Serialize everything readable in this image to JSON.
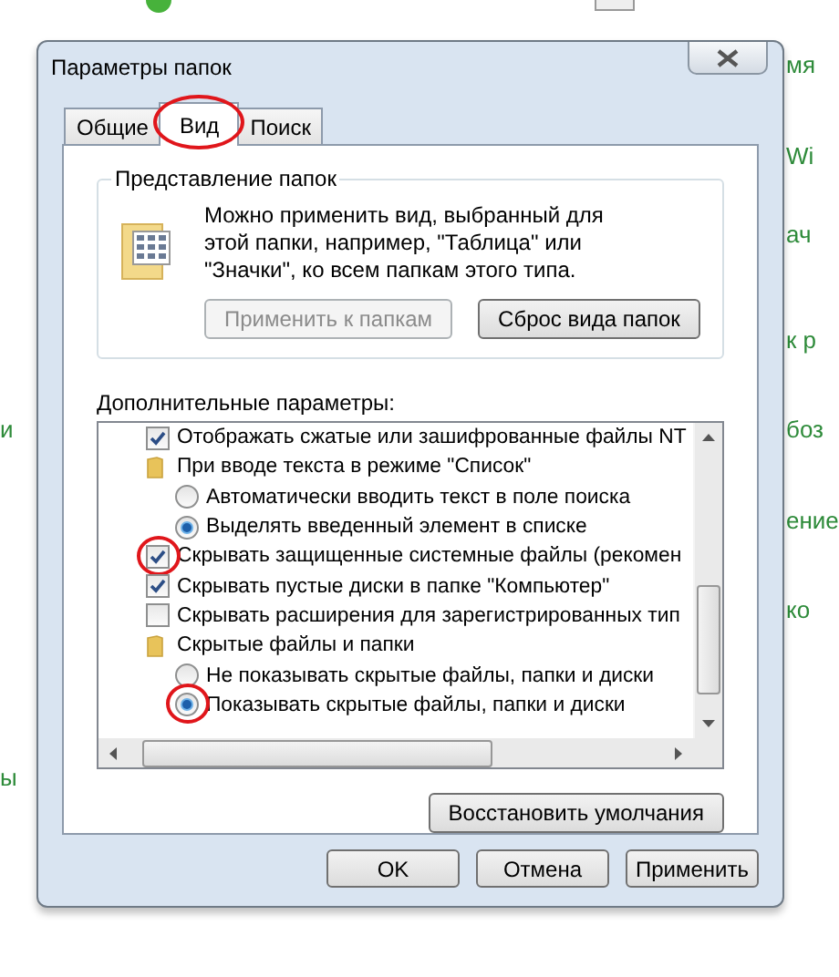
{
  "background": {
    "right_fragments": [
      "мя",
      "Wi",
      "ач",
      "к р",
      "боз",
      "ение",
      "ко"
    ],
    "left_fragments": [
      "и",
      "ы"
    ]
  },
  "window": {
    "title": "Параметры папок"
  },
  "tabs": [
    {
      "label": "Общие",
      "selected": false,
      "circled": false
    },
    {
      "label": "Вид",
      "selected": true,
      "circled": true
    },
    {
      "label": "Поиск",
      "selected": false,
      "circled": false
    }
  ],
  "folder_views": {
    "title": "Представление папок",
    "description": "Можно применить вид, выбранный для этой папки, например, \"Таблица\" или \"Значки\", ко всем папкам этого типа.",
    "buttons": [
      {
        "label": "Применить к папкам",
        "disabled": true
      },
      {
        "label": "Сброс вида папок",
        "disabled": false
      }
    ]
  },
  "advanced": {
    "title": "Дополнительные параметры:",
    "items": [
      {
        "kind": "checkbox",
        "label": "Отображать сжатые или зашифрованные файлы NT",
        "checked": true,
        "circled": false
      },
      {
        "kind": "folder",
        "label": "При вводе текста в режиме \"Список\"",
        "children": [
          {
            "kind": "radio",
            "label": "Автоматически вводить текст в поле поиска",
            "selected": false,
            "circled": false
          },
          {
            "kind": "radio",
            "label": "Выделять введенный элемент в списке",
            "selected": true,
            "circled": false
          }
        ]
      },
      {
        "kind": "checkbox",
        "label": "Скрывать защищенные системные файлы (рекомен",
        "checked": true,
        "circled": true
      },
      {
        "kind": "checkbox",
        "label": "Скрывать пустые диски в папке \"Компьютер\"",
        "checked": true,
        "circled": false
      },
      {
        "kind": "checkbox",
        "label": "Скрывать расширения для зарегистрированных тип",
        "checked": false,
        "circled": false
      },
      {
        "kind": "folder",
        "label": "Скрытые файлы и папки",
        "children": [
          {
            "kind": "radio",
            "label": "Не показывать скрытые файлы, папки и диски",
            "selected": false,
            "circled": false
          },
          {
            "kind": "radio",
            "label": "Показывать скрытые файлы, папки и диски",
            "selected": true,
            "circled": true
          }
        ]
      }
    ]
  },
  "restore_button": "Восстановить умолчания",
  "buttons": [
    "OK",
    "Отмена",
    "Применить"
  ]
}
